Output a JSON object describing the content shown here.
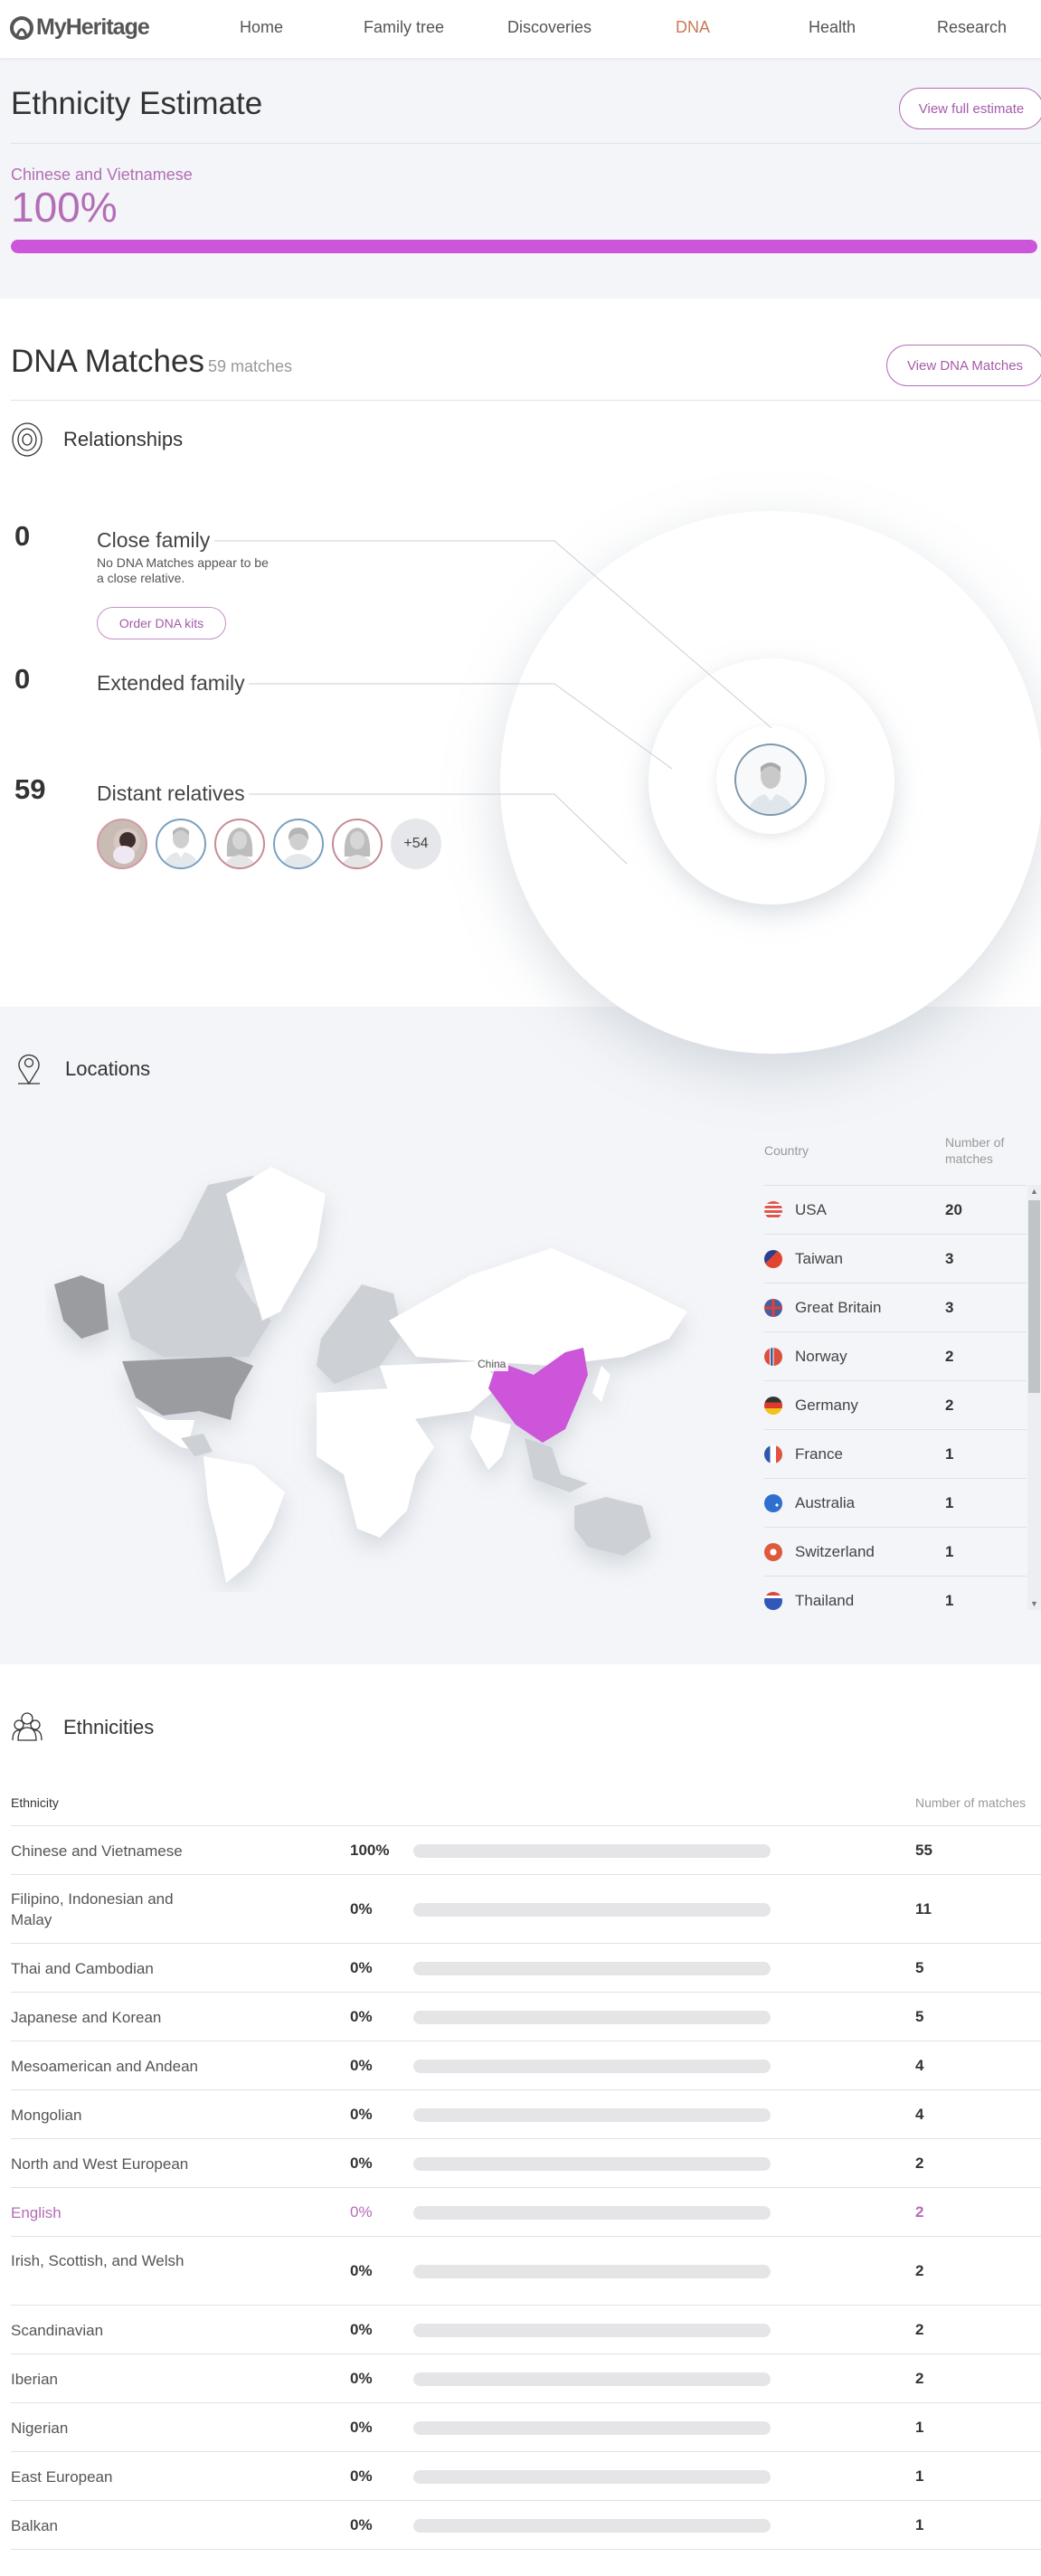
{
  "nav": {
    "logo": "MyHeritage",
    "items": [
      {
        "label": "Home",
        "active": false
      },
      {
        "label": "Family tree",
        "active": false
      },
      {
        "label": "Discoveries",
        "active": false
      },
      {
        "label": "DNA",
        "active": true
      },
      {
        "label": "Health",
        "active": false
      },
      {
        "label": "Research",
        "active": false
      }
    ]
  },
  "colors": {
    "accent": "#b46db7",
    "bar_fill": "#cc55d9",
    "nav_active": "#c87a53",
    "bg_light": "#f3f5f8"
  },
  "ethnicity_estimate": {
    "title": "Ethnicity Estimate",
    "button": "View full estimate",
    "top_ethnicity": "Chinese and Vietnamese",
    "top_percent_label": "100%",
    "top_percent": 100
  },
  "dna_matches": {
    "title": "DNA Matches",
    "count_label": "59 matches",
    "button": "View DNA Matches",
    "relationships": {
      "title": "Relationships",
      "icon": "target-rings-icon",
      "groups": [
        {
          "count": "0",
          "label": "Close family",
          "description": "No DNA Matches appear to be a close relative.",
          "button": "Order DNA kits"
        },
        {
          "count": "0",
          "label": "Extended family"
        },
        {
          "count": "59",
          "label": "Distant relatives",
          "avatars": [
            {
              "type": "photo"
            },
            {
              "type": "male"
            },
            {
              "type": "female"
            },
            {
              "type": "male"
            },
            {
              "type": "female"
            }
          ],
          "more_label": "+54"
        }
      ]
    }
  },
  "locations": {
    "title": "Locations",
    "icon": "map-pin-icon",
    "map_highlight_label": "China",
    "table": {
      "col_country": "Country",
      "col_count": "Number of matches",
      "rows": [
        {
          "country": "USA",
          "count": "20",
          "flag": "us-flag-icon"
        },
        {
          "country": "Taiwan",
          "count": "3",
          "flag": "taiwan-flag-icon"
        },
        {
          "country": "Great Britain",
          "count": "3",
          "flag": "uk-flag-icon"
        },
        {
          "country": "Norway",
          "count": "2",
          "flag": "norway-flag-icon"
        },
        {
          "country": "Germany",
          "count": "2",
          "flag": "germany-flag-icon"
        },
        {
          "country": "France",
          "count": "1",
          "flag": "france-flag-icon"
        },
        {
          "country": "Australia",
          "count": "1",
          "flag": "australia-flag-icon"
        },
        {
          "country": "Switzerland",
          "count": "1",
          "flag": "switzerland-flag-icon"
        },
        {
          "country": "Thailand",
          "count": "1",
          "flag": "thailand-flag-icon"
        }
      ]
    }
  },
  "ethnicities": {
    "title": "Ethnicities",
    "icon": "people-group-icon",
    "col_ethnicity": "Ethnicity",
    "col_count": "Number of matches",
    "rows": [
      {
        "name": "Chinese and Vietnamese",
        "percent": "100%",
        "count": "55"
      },
      {
        "name": "Filipino, Indonesian and Malay",
        "percent": "0%",
        "count": "11"
      },
      {
        "name": "Thai and Cambodian",
        "percent": "0%",
        "count": "5"
      },
      {
        "name": "Japanese and Korean",
        "percent": "0%",
        "count": "5"
      },
      {
        "name": "Mesoamerican and Andean",
        "percent": "0%",
        "count": "4"
      },
      {
        "name": "Mongolian",
        "percent": "0%",
        "count": "4"
      },
      {
        "name": "North and West European",
        "percent": "0%",
        "count": "2"
      },
      {
        "name": "English",
        "percent": "0%",
        "count": "2",
        "highlighted": true
      },
      {
        "name": "Irish, Scottish, and Welsh",
        "percent": "0%",
        "count": "2"
      },
      {
        "name": "Scandinavian",
        "percent": "0%",
        "count": "2"
      },
      {
        "name": "Iberian",
        "percent": "0%",
        "count": "2"
      },
      {
        "name": "Nigerian",
        "percent": "0%",
        "count": "1"
      },
      {
        "name": "East European",
        "percent": "0%",
        "count": "1"
      },
      {
        "name": "Balkan",
        "percent": "0%",
        "count": "1"
      }
    ]
  }
}
